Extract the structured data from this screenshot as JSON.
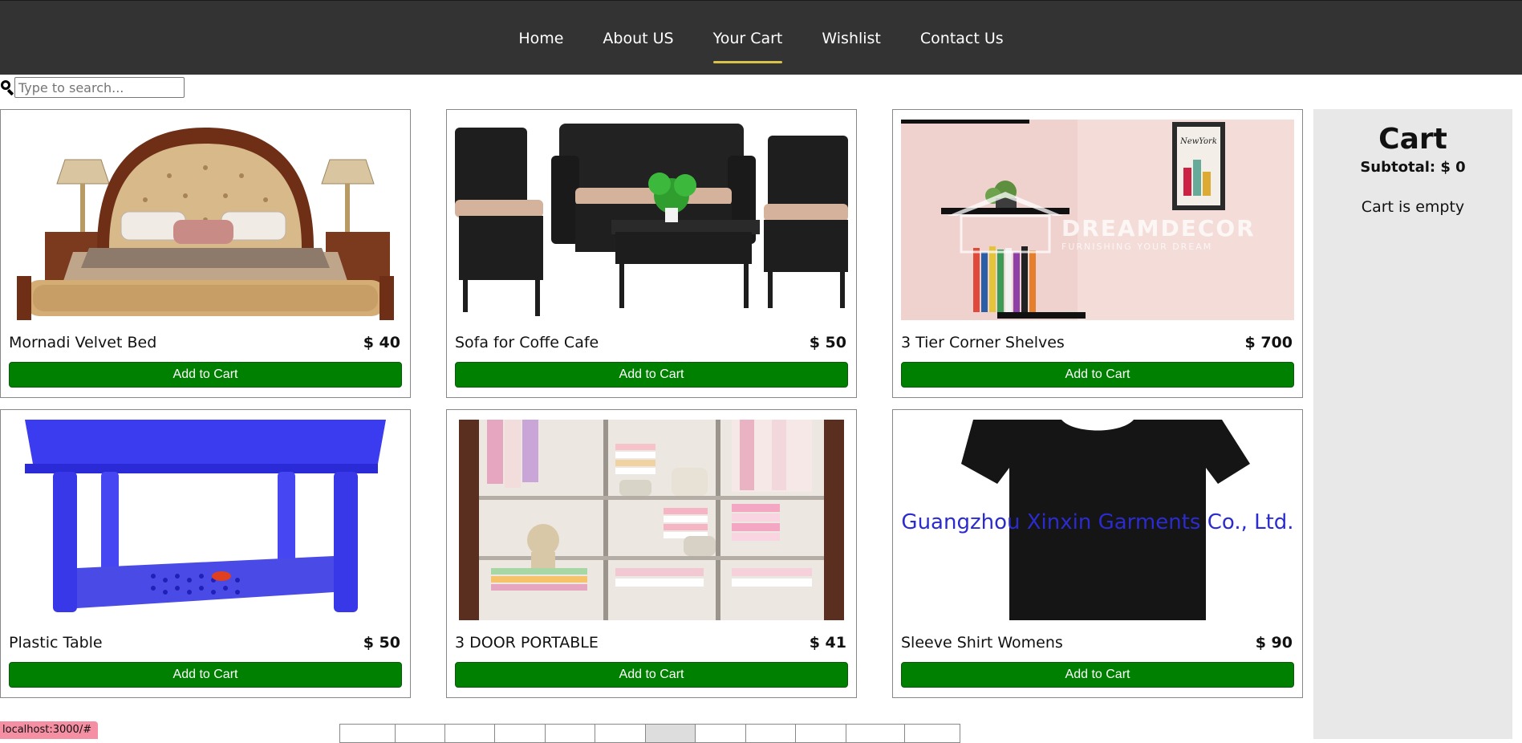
{
  "nav": {
    "items": [
      {
        "label": "Home",
        "active": false
      },
      {
        "label": "About US",
        "active": false
      },
      {
        "label": "Your Cart",
        "active": true
      },
      {
        "label": "Wishlist",
        "active": false
      },
      {
        "label": "Contact Us",
        "active": false
      }
    ]
  },
  "search": {
    "placeholder": "Type to search..."
  },
  "products": [
    {
      "name": "Mornadi Velvet Bed",
      "price": "$ 40",
      "button": "Add to Cart",
      "image": "bed-image"
    },
    {
      "name": "Sofa for Coffe Cafe",
      "price": "$ 50",
      "button": "Add to Cart",
      "image": "sofa-image"
    },
    {
      "name": "3 Tier Corner Shelves",
      "price": "$ 700",
      "button": "Add to Cart",
      "image": "shelves-image"
    },
    {
      "name": "Plastic Table",
      "price": "$ 50",
      "button": "Add to Cart",
      "image": "table-image"
    },
    {
      "name": "3 DOOR PORTABLE",
      "price": "$ 41",
      "button": "Add to Cart",
      "image": "wardrobe-image"
    },
    {
      "name": "Sleeve Shirt Womens",
      "price": "$ 90",
      "button": "Add to Cart",
      "image": "shirt-image"
    }
  ],
  "image_text": {
    "shelves_watermark": "DREAMDECOR",
    "shelves_watermark_sub": "FURNISHING YOUR DREAM",
    "shelves_poster": "NewYork",
    "shirt_watermark": "Guangzhou Xinxin Garments Co., Ltd."
  },
  "cart": {
    "title": "Cart",
    "subtotal": "Subtotal: $ 0",
    "empty_message": "Cart is empty"
  },
  "pagination": {
    "active_index": 6,
    "count": 12
  },
  "status": {
    "url": "localhost:3000/#"
  },
  "colors": {
    "nav_bg": "#333333",
    "nav_active_underline": "#d8c24a",
    "button_green": "#008000",
    "cart_bg": "#e8e8e8"
  }
}
